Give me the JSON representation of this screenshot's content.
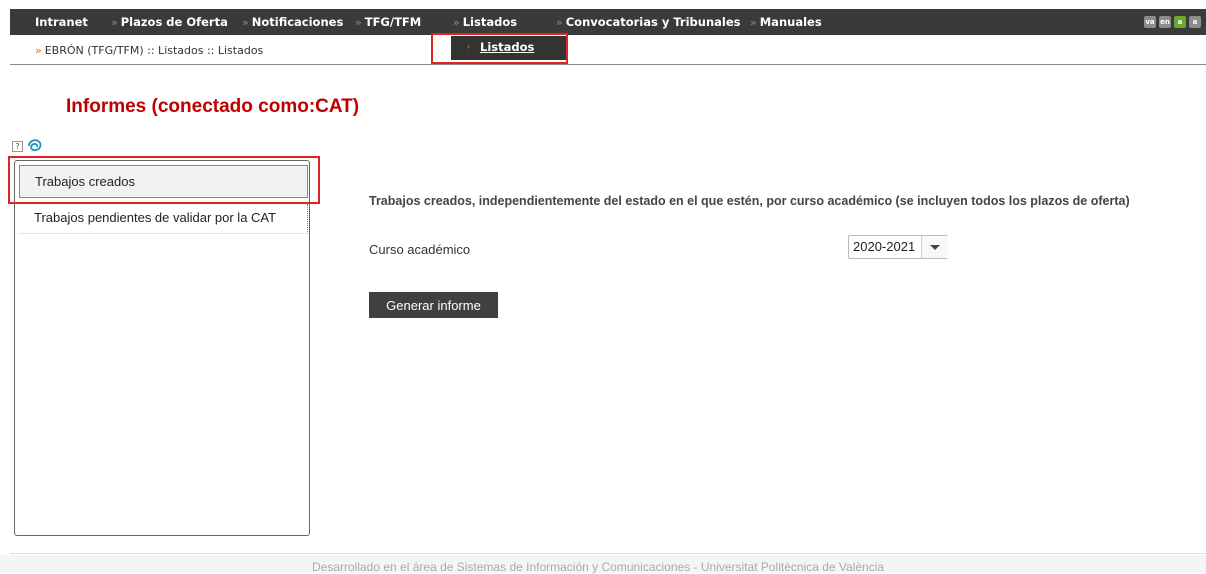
{
  "nav": {
    "items": [
      {
        "label": "Intranet",
        "chevron": false
      },
      {
        "label": "Plazos de Oferta",
        "chevron": true
      },
      {
        "label": "Notificaciones",
        "chevron": true
      },
      {
        "label": "TFG/TFM",
        "chevron": true
      },
      {
        "label": "Listados",
        "chevron": true
      },
      {
        "label": "Convocatorias y Tribunales",
        "chevron": true
      },
      {
        "label": "Manuales",
        "chevron": true
      }
    ],
    "chevron_glyph": "»",
    "languages": [
      {
        "code": "va",
        "color": "#8c8c8c"
      },
      {
        "code": "en",
        "color": "#8c8c8c"
      },
      {
        "code": "a",
        "color": "#6aa832"
      },
      {
        "code": "a",
        "color": "#8c8c8c"
      }
    ],
    "bg_color": "#3a3a3a"
  },
  "breadcrumb": {
    "arrow": "»",
    "text": "EBRÓN (TFG/TFM) :: Listados :: Listados"
  },
  "dropdown": {
    "arrow": "›",
    "label": "Listados"
  },
  "page": {
    "title": "Informes (conectado como:CAT)",
    "title_color": "#c00000",
    "help_icon": "?"
  },
  "sidebar": {
    "tabs": [
      {
        "label": "Trabajos creados",
        "active": true
      },
      {
        "label": "Trabajos pendientes de validar por la CAT",
        "active": false
      }
    ]
  },
  "report": {
    "description": "Trabajos creados, independientemente del estado en el que estén, por curso académico (se incluyen todos los plazos de oferta)",
    "curso_label": "Curso académico",
    "curso_value": "2020-2021",
    "generate_label": "Generar informe"
  },
  "footer": {
    "text": "Desarrollado en el área de Sistemas de Información y Comunicaciones  - Universitat Politècnica de València"
  },
  "highlight_color": "#e02424"
}
